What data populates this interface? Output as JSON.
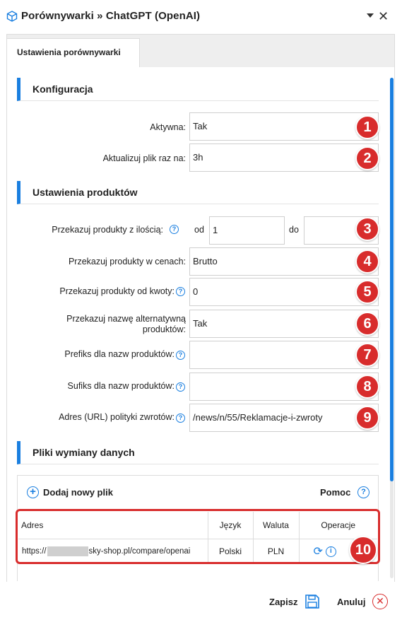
{
  "window": {
    "title": "Porównywarki » ChatGPT (OpenAI)",
    "icon": "cube-icon",
    "close_glyph": "✕"
  },
  "tabs": [
    {
      "label": "Ustawienia porównywarki",
      "active": true
    }
  ],
  "sections": {
    "config": "Konfiguracja",
    "products": "Ustawienia produktów",
    "files": "Pliki wymiany danych"
  },
  "fields": {
    "active": {
      "label": "Aktywna:",
      "value": "Tak"
    },
    "update": {
      "label": "Aktualizuj plik raz na:",
      "value": "3h"
    },
    "qty": {
      "label": "Przekazuj produkty z ilością:",
      "from_label": "od",
      "from_value": "1",
      "to_label": "do",
      "to_value": ""
    },
    "prices": {
      "label": "Przekazuj produkty w cenach:",
      "value": "Brutto"
    },
    "min_amount": {
      "label": "Przekazuj produkty od kwoty:",
      "value": "0"
    },
    "alt_name": {
      "label_line1": "Przekazuj nazwę alternatywną",
      "label_line2": "produktów:",
      "value": "Tak"
    },
    "prefix": {
      "label": "Prefiks dla nazw produktów:",
      "value": ""
    },
    "suffix": {
      "label": "Sufiks dla nazw produktów:",
      "value": ""
    },
    "returns_url": {
      "label": "Adres (URL) polityki zwrotów:",
      "value": "/news/n/55/Reklamacje-i-zwroty"
    }
  },
  "help_glyph": "?",
  "markers": [
    "1",
    "2",
    "3",
    "4",
    "5",
    "6",
    "7",
    "8",
    "9",
    "10"
  ],
  "files": {
    "add_label": "Dodaj nowy plik",
    "help_label": "Pomoc",
    "columns": [
      "Adres",
      "Język",
      "Waluta",
      "Operacje"
    ],
    "rows": [
      {
        "url_start": "https://",
        "url_end": "sky-shop.pl/compare/openai",
        "language": "Polski",
        "currency": "PLN"
      }
    ]
  },
  "footer": {
    "save_label": "Zapisz",
    "cancel_label": "Anuluj"
  },
  "colors": {
    "accent": "#1a7fe0",
    "marker": "#d82c2c"
  }
}
